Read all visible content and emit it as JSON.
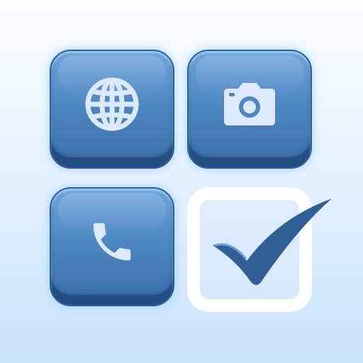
{
  "app_grid": {
    "tiles": [
      {
        "icon": "globe-icon"
      },
      {
        "icon": "camera-icon"
      },
      {
        "icon": "phone-icon"
      },
      {
        "icon": "checkbox-checked-icon"
      }
    ]
  },
  "colors": {
    "background_top": "#fbfdff",
    "background_bottom": "#c9e3fb",
    "tile_light": "#6fa6dc",
    "tile_dark": "#3a6fa9",
    "glyph": "#dbe9f8",
    "checkbox_border": "#ffffff",
    "checkmark": "#2f5f95"
  }
}
